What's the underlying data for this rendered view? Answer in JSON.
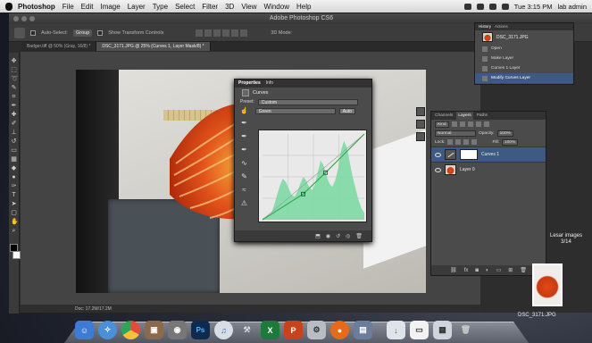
{
  "menubar": {
    "app": "Photoshop",
    "items": [
      "File",
      "Edit",
      "Image",
      "Layer",
      "Type",
      "Select",
      "Filter",
      "3D",
      "View",
      "Window",
      "Help"
    ],
    "clock": "Tue 3:15 PM",
    "user": "lab admin"
  },
  "window": {
    "title": "Adobe Photoshop CS6"
  },
  "options": {
    "auto_select": "Auto-Select:",
    "auto_select_value": "Group",
    "show_transform": "Show Transform Controls",
    "mode_3d": "3D Mode:"
  },
  "tabs": [
    {
      "label": "Badger.tiff @ 50% (Gray, 16/8) *"
    },
    {
      "label": "DSC_3171.JPG @ 25% (Curves 1, Layer Mask/8) *"
    }
  ],
  "status": "Doc: 17.2M/17.2M",
  "properties": {
    "tabs": [
      "Properties",
      "Info"
    ],
    "title": "Curves",
    "preset_label": "Preset:",
    "preset_value": "Custom",
    "channel_value": "Green",
    "auto_label": "Auto"
  },
  "curve_data": {
    "histogram": [
      2,
      3,
      5,
      8,
      18,
      30,
      42,
      50,
      46,
      38,
      30,
      28,
      34,
      44,
      52,
      48,
      40,
      36,
      42,
      58,
      72,
      66,
      54,
      44,
      40,
      48,
      62,
      84,
      96,
      88,
      70,
      52,
      38,
      24,
      14,
      8
    ],
    "curve_points": [
      [
        0,
        0
      ],
      [
        40,
        30
      ],
      [
        62,
        55
      ],
      [
        100,
        100
      ]
    ]
  },
  "layers": {
    "tabs": [
      "Channels",
      "Layers",
      "Paths"
    ],
    "kind_label": "Kind",
    "blend_mode": "Normal",
    "opacity_label": "Opacity:",
    "opacity_value": "100%",
    "lock_label": "Lock:",
    "fill_label": "Fill:",
    "fill_value": "100%",
    "items": [
      {
        "name": "Curves 1",
        "selected": true
      },
      {
        "name": "Layer 0",
        "selected": false
      }
    ]
  },
  "history": {
    "tabs": [
      "History",
      "Actions"
    ],
    "snapshot": "DSC_3171.JPG",
    "items": [
      {
        "label": "Open",
        "selected": false
      },
      {
        "label": "Make Layer",
        "selected": false
      },
      {
        "label": "Curves 1 Layer",
        "selected": false
      },
      {
        "label": "Modify Curves Layer",
        "selected": true
      }
    ]
  },
  "desktop": {
    "label_top_1": "Lesar images",
    "label_top_2": "3/14",
    "file_label": "DSC_3171.JPG"
  },
  "colors": {
    "selection": "#3f5a82",
    "histogram": "#7fd9a5",
    "curve_line": "#2fae4e"
  }
}
